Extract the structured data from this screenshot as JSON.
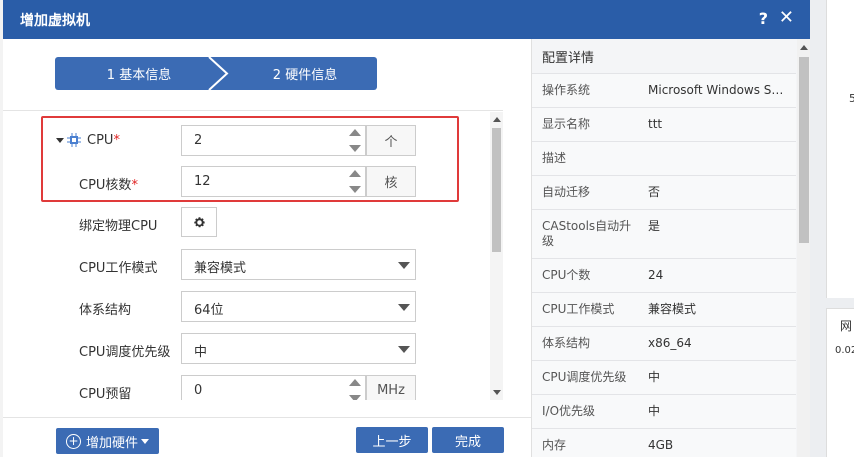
{
  "dialog": {
    "title": "增加虚拟机",
    "help_label": "?",
    "close_label": "✕"
  },
  "steps": [
    {
      "label": "1 基本信息"
    },
    {
      "label": "2 硬件信息"
    }
  ],
  "form": {
    "cpu": {
      "label": "CPU",
      "required_mark": "*",
      "value": "2",
      "unit": "个"
    },
    "cpu_cores": {
      "label": "CPU核数",
      "required_mark": "*",
      "value": "12",
      "unit": "核"
    },
    "bind_cpu": {
      "label": "绑定物理CPU"
    },
    "cpu_mode": {
      "label": "CPU工作模式",
      "value": "兼容模式"
    },
    "arch": {
      "label": "体系结构",
      "value": "64位"
    },
    "priority": {
      "label": "CPU调度优先级",
      "value": "中"
    },
    "reserve": {
      "label": "CPU预留",
      "value": "0",
      "unit": "MHz"
    }
  },
  "footer": {
    "add_hw_label": "增加硬件",
    "prev_label": "上一步",
    "done_label": "完成"
  },
  "config": {
    "title": "配置详情",
    "rows": [
      {
        "key": "操作系统",
        "value": "Microsoft Windows Ser..."
      },
      {
        "key": "显示名称",
        "value": "ttt"
      },
      {
        "key": "描述",
        "value": ""
      },
      {
        "key": "自动迁移",
        "value": "否"
      },
      {
        "key": "CAStools自动升级",
        "value": "是"
      },
      {
        "key": "CPU个数",
        "value": "24"
      },
      {
        "key": "CPU工作模式",
        "value": "兼容模式"
      },
      {
        "key": "体系结构",
        "value": "x86_64"
      },
      {
        "key": "CPU调度优先级",
        "value": "中"
      },
      {
        "key": "I/O优先级",
        "value": "中"
      },
      {
        "key": "内存",
        "value": "4GB"
      }
    ]
  },
  "background": {
    "fragment_number": "5",
    "fragment_label": "网",
    "fragment_value": "0.02"
  },
  "colors": {
    "accent": "#2a5da8",
    "button": "#3b6bb4",
    "highlight": "#e03a3a"
  }
}
